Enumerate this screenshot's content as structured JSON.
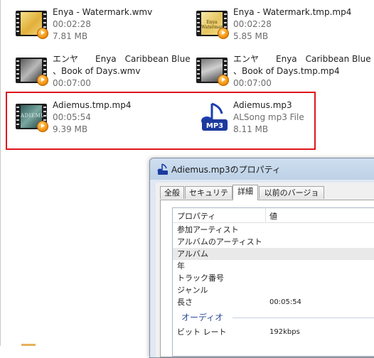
{
  "files": [
    {
      "name": "Enya - Watermark.wmv",
      "line2": "00:02:28",
      "line3": "7.81 MB",
      "icon": "video-thumbnail-icon"
    },
    {
      "name": "Enya - Watermark.tmp.mp4",
      "line2": "00:02:28",
      "line3": "5.85 MB",
      "icon": "video-thumbnail-icon",
      "thumb_text": "Enya Watermark"
    },
    {
      "name": "エンヤ　　Enya　Caribbean Blue",
      "name2": "、Book of Days.wmv",
      "line2": "00:07:00",
      "icon": "video-thumbnail-icon"
    },
    {
      "name": "エンヤ　　Enya　Caribbean Blue",
      "name2": "、Book of Days.tmp.mp4",
      "line2": "00:07:00",
      "icon": "video-thumbnail-icon"
    },
    {
      "name": "Adiemus.tmp.mp4",
      "line2": "00:05:54",
      "line3": "9.39 MB",
      "icon": "video-thumbnail-icon",
      "thumb_text": "ADIEMUS"
    },
    {
      "name": "Adiemus.mp3",
      "line2": "ALSong mp3 File",
      "line3": "8.11 MB",
      "icon": "mp3-file-icon",
      "icon_label": "MP3"
    }
  ],
  "dialog": {
    "title": "Adiemus.mp3のプロパティ",
    "tabs": [
      {
        "label": "全般"
      },
      {
        "label": "セキュリティ"
      },
      {
        "label": "詳細",
        "active": true
      },
      {
        "label": "以前のバージョン"
      }
    ],
    "header": {
      "property": "プロパティ",
      "value": "値"
    },
    "rows": [
      {
        "key": "参加アーティスト",
        "value": ""
      },
      {
        "key": "アルバムのアーティスト",
        "value": ""
      },
      {
        "key": "アルバム",
        "value": ""
      },
      {
        "key": "年",
        "value": ""
      },
      {
        "key": "トラック番号",
        "value": ""
      },
      {
        "key": "ジャンル",
        "value": ""
      },
      {
        "key": "長さ",
        "value": "00:05:54"
      }
    ],
    "group": "オーディオ",
    "audio_rows": [
      {
        "key": "ビット レート",
        "value": "192kbps"
      }
    ]
  },
  "colors": {
    "selection": "#e0141b",
    "group_heading": "#2a4a9a",
    "meta_text": "#6d6d6d"
  }
}
